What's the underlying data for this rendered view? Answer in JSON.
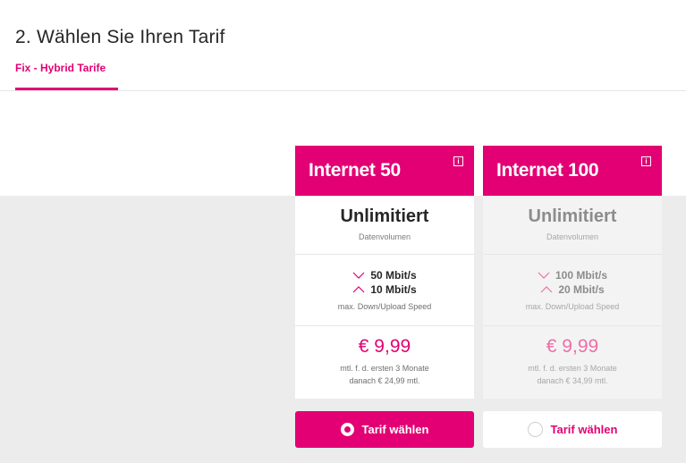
{
  "header": {
    "title": "2. Wählen Sie Ihren Tarif",
    "tab_label": "Fix - Hybrid Tarife"
  },
  "colors": {
    "accent": "#e20074",
    "band_grey": "#ececec"
  },
  "tariffs": [
    {
      "name": "Internet 50",
      "info_icon": "i",
      "volume": "Unlimitiert",
      "volume_label": "Datenvolumen",
      "download": "50 Mbit/s",
      "upload": "10 Mbit/s",
      "speed_label": "max. Down/Upload Speed",
      "price": "€ 9,99",
      "price_note": "mtl. f. d. ersten 3 Monate",
      "price_after": "danach € 24,99 mtl.",
      "button_label": "Tarif wählen",
      "selected": true
    },
    {
      "name": "Internet 100",
      "info_icon": "i",
      "volume": "Unlimitiert",
      "volume_label": "Datenvolumen",
      "download": "100 Mbit/s",
      "upload": "20 Mbit/s",
      "speed_label": "max. Down/Upload Speed",
      "price": "€ 9,99",
      "price_note": "mtl. f. d. ersten 3 Monate",
      "price_after": "danach € 34,99 mtl.",
      "button_label": "Tarif wählen",
      "selected": false
    }
  ]
}
